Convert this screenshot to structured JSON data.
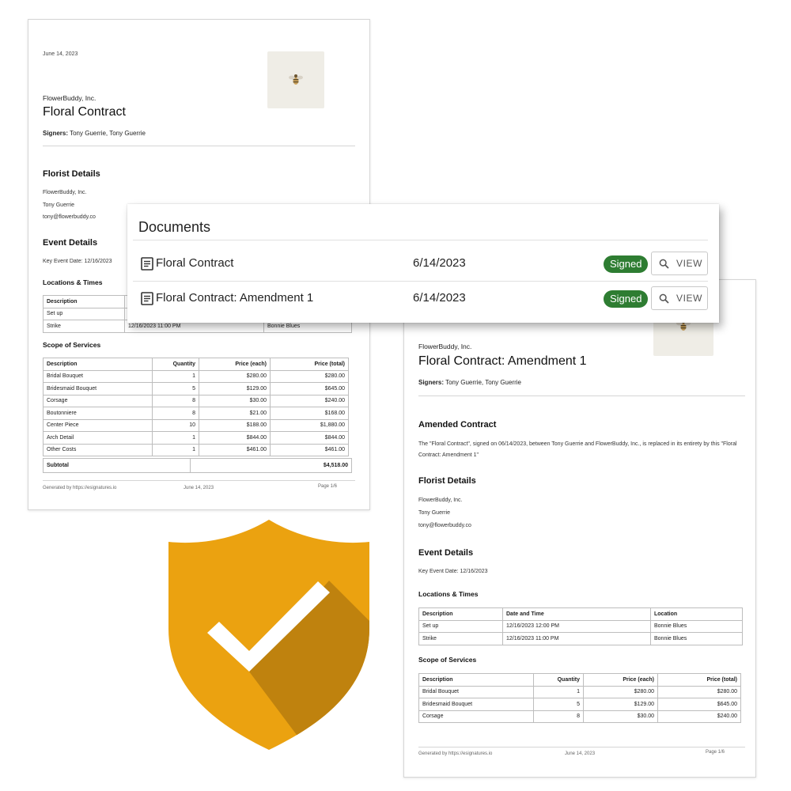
{
  "contract_page": {
    "date": "June 14, 2023",
    "company": "FlowerBuddy, Inc.",
    "title": "Floral Contract",
    "signers_label": "Signers:",
    "signers": "Tony Guerrie, Tony Guerrie",
    "florist_heading": "Florist Details",
    "florist_company": "FlowerBuddy, Inc.",
    "florist_name": "Tony Guerrie",
    "florist_email": "tony@flowerbuddy.co",
    "event_heading": "Event Details",
    "key_event_date": "Key Event Date: 12/16/2023",
    "locations_heading": "Locations & Times",
    "locations_table": {
      "headers": [
        "Description",
        "",
        ""
      ],
      "rows": [
        [
          "Set up",
          "",
          ""
        ],
        [
          "Strike",
          "12/16/2023 11:00 PM",
          "Bonnie Blues"
        ]
      ]
    },
    "scope_heading": "Scope of Services",
    "scope_table": {
      "headers": [
        "Description",
        "Quantity",
        "Price (each)",
        "Price (total)"
      ],
      "rows": [
        [
          "Bridal Bouquet",
          "1",
          "$280.00",
          "$280.00"
        ],
        [
          "Bridesmaid Bouquet",
          "5",
          "$129.00",
          "$645.00"
        ],
        [
          "Corsage",
          "8",
          "$30.00",
          "$240.00"
        ],
        [
          "Boutonniere",
          "8",
          "$21.00",
          "$168.00"
        ],
        [
          "Center Piece",
          "10",
          "$188.00",
          "$1,880.00"
        ],
        [
          "Arch Detail",
          "1",
          "$844.00",
          "$844.00"
        ],
        [
          "Other Costs",
          "1",
          "$461.00",
          "$461.00"
        ]
      ],
      "subtotal_label": "Subtotal",
      "subtotal_value": "$4,518.00"
    },
    "footer_generated": "Generated by https://esignatures.io",
    "footer_date": "June 14, 2023",
    "footer_page": "Page 1/6"
  },
  "amendment_page": {
    "company": "FlowerBuddy, Inc.",
    "title": "Floral Contract: Amendment 1",
    "signers_label": "Signers:",
    "signers": "Tony Guerrie, Tony Guerrie",
    "amended_heading": "Amended Contract",
    "amended_text": "The \"Floral Contract\", signed on 06/14/2023, between Tony Guerrie and FlowerBuddy, Inc., is replaced in its entirety by this \"Floral Contract: Amendment 1\"",
    "florist_heading": "Florist Details",
    "florist_company": "FlowerBuddy, Inc.",
    "florist_name": "Tony Guerrie",
    "florist_email": "tony@flowerbuddy.co",
    "event_heading": "Event Details",
    "key_event_date": "Key Event Date: 12/16/2023",
    "locations_heading": "Locations & Times",
    "locations_table": {
      "headers": [
        "Description",
        "Date and Time",
        "Location"
      ],
      "rows": [
        [
          "Set up",
          "12/16/2023 12:00 PM",
          "Bonnie Blues"
        ],
        [
          "Strike",
          "12/16/2023 11:00 PM",
          "Bonnie Blues"
        ]
      ]
    },
    "scope_heading": "Scope of Services",
    "scope_table": {
      "headers": [
        "Description",
        "Quantity",
        "Price (each)",
        "Price (total)"
      ],
      "rows": [
        [
          "Bridal Bouquet",
          "1",
          "$280.00",
          "$280.00"
        ],
        [
          "Bridesmaid Bouquet",
          "5",
          "$129.00",
          "$645.00"
        ],
        [
          "Corsage",
          "8",
          "$30.00",
          "$240.00"
        ]
      ]
    },
    "footer_generated": "Generated by https://esignatures.io",
    "footer_date": "June 14, 2023",
    "footer_page": "Page 1/6"
  },
  "documents_panel": {
    "title": "Documents",
    "items": [
      {
        "name": "Floral Contract",
        "date": "6/14/2023",
        "status": "Signed",
        "action": "VIEW",
        "icon": "document-icon"
      },
      {
        "name": "Floral Contract: Amendment 1",
        "date": "6/14/2023",
        "status": "Signed",
        "action": "VIEW",
        "icon": "document-icon"
      }
    ]
  },
  "colors": {
    "signed_badge": "#2e7d32",
    "shield_light": "#eba210",
    "shield_dark": "#bf820e",
    "checkmark": "#ffffff"
  },
  "shield_icon": "shield-check-icon"
}
